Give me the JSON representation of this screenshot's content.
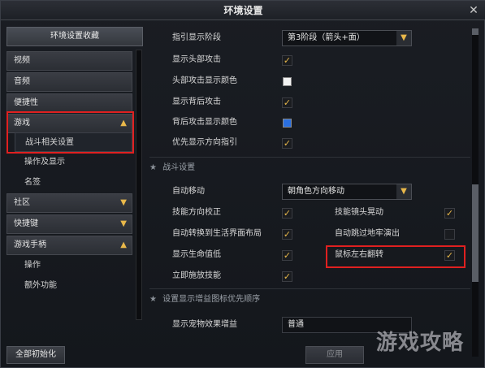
{
  "window": {
    "title": "环境设置",
    "close_glyph": "✕"
  },
  "sidebar": {
    "favorites_label": "环境设置收藏",
    "items": [
      {
        "label": "视频"
      },
      {
        "label": "音频"
      },
      {
        "label": "便捷性"
      },
      {
        "label": "游戏",
        "chevron": "▲"
      },
      {
        "label": "战斗相关设置",
        "sub": true,
        "active": true
      },
      {
        "label": "操作及显示",
        "sub": true
      },
      {
        "label": "名签",
        "sub": true
      },
      {
        "label": "社区",
        "chevron": "▼"
      },
      {
        "label": "快捷键",
        "chevron": "▼"
      },
      {
        "label": "游戏手柄",
        "chevron": "▲"
      },
      {
        "label": "操作",
        "sub": true
      },
      {
        "label": "额外功能",
        "sub": true
      }
    ],
    "reset_label": "全部初始化"
  },
  "content": {
    "top_rows": {
      "indicator_stage": {
        "label": "指引显示阶段",
        "value": "第3阶段（箭头+面）"
      },
      "show_head_attack": {
        "label": "显示头部攻击",
        "checked": true
      },
      "head_attack_color": {
        "label": "头部攻击显示颜色",
        "color": "#f2f2f2"
      },
      "show_back_attack": {
        "label": "显示背后攻击",
        "checked": true
      },
      "back_attack_color": {
        "label": "背后攻击显示颜色",
        "color": "#2a6fe0"
      },
      "direction_priority": {
        "label": "优先显示方向指引",
        "checked": true
      }
    },
    "combat_section": {
      "title": "战斗设置",
      "auto_move": {
        "label": "自动移动",
        "value": "朝角色方向移动"
      },
      "skill_dir_correct": {
        "label": "技能方向校正",
        "checked": true
      },
      "skill_cam_shake": {
        "label": "技能镜头晃动",
        "checked": true
      },
      "auto_switch_life": {
        "label": "自动转换到生活界面布局",
        "checked": true
      },
      "auto_skip_dungeon": {
        "label": "自动跳过地牢演出",
        "checked": false
      },
      "show_hp": {
        "label": "显示生命值低",
        "checked": true
      },
      "mouse_flip": {
        "label": "鼠标左右翻转",
        "checked": true
      },
      "instant_cast": {
        "label": "立即施放技能",
        "checked": true
      }
    },
    "buff_section": {
      "title": "设置显示增益图标优先顺序",
      "pet_buff": {
        "label": "显示宠物效果增益",
        "value": "普通"
      }
    },
    "apply_label": "应用"
  },
  "icons": {
    "check": "✓",
    "star": "★",
    "dropdown": "▼"
  },
  "watermark": "游戏攻略"
}
